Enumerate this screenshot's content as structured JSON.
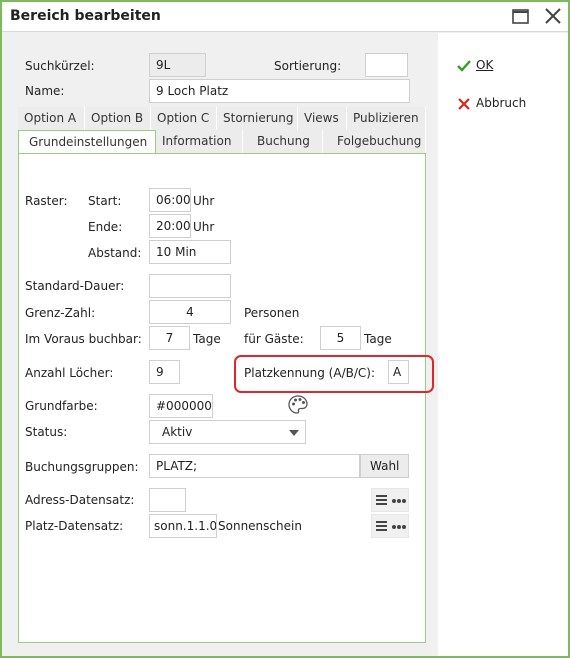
{
  "window": {
    "title": "Bereich bearbeiten"
  },
  "header": {
    "suchkuerzel_label": "Suchkürzel:",
    "suchkuerzel_value": "9L",
    "sortierung_label": "Sortierung:",
    "sortierung_value": "",
    "name_label": "Name:",
    "name_value": "9 Loch Platz"
  },
  "tabs": {
    "row1": [
      "Option A",
      "Option B",
      "Option C",
      "Stornierung",
      "Views",
      "Publizieren"
    ],
    "row2": [
      "Grundeinstellungen",
      "Information",
      "Buchung",
      "Folgebuchung"
    ],
    "active": "Grundeinstellungen"
  },
  "form": {
    "raster_label": "Raster:",
    "start_label": "Start:",
    "start_value": "06:00",
    "start_unit": "Uhr",
    "ende_label": "Ende:",
    "ende_value": "20:00",
    "ende_unit": "Uhr",
    "abstand_label": "Abstand:",
    "abstand_value": "10 Min",
    "standard_dauer_label": "Standard-Dauer:",
    "standard_dauer_value": "",
    "grenz_zahl_label": "Grenz-Zahl:",
    "grenz_zahl_value": "4",
    "grenz_zahl_unit": "Personen",
    "voraus_label": "Im Voraus buchbar:",
    "voraus_value": "7",
    "voraus_unit": "Tage",
    "gaeste_label": "für Gäste:",
    "gaeste_value": "5",
    "gaeste_unit": "Tage",
    "loecher_label": "Anzahl Löcher:",
    "loecher_value": "9",
    "platzkennung_label": "Platzkennung (A/B/C):",
    "platzkennung_value": "A",
    "grundfarbe_label": "Grundfarbe:",
    "grundfarbe_value": "#000000",
    "status_label": "Status:",
    "status_value": "Aktiv",
    "buchungsgruppen_label": "Buchungsgruppen:",
    "buchungsgruppen_value": "PLATZ;",
    "wahl_label": "Wahl",
    "adress_label": "Adress-Datensatz:",
    "adress_value": "",
    "platz_label": "Platz-Datensatz:",
    "platz_value": "sonn.1.1.0",
    "platz_name": "Sonnenschein"
  },
  "actions": {
    "ok_label": "OK",
    "abbruch_label": "Abbruch"
  },
  "colors": {
    "accent_border": "#7cba5b",
    "highlight": "#e0262a",
    "ok_check": "#3a9a2a",
    "cancel_x": "#d9261c"
  }
}
